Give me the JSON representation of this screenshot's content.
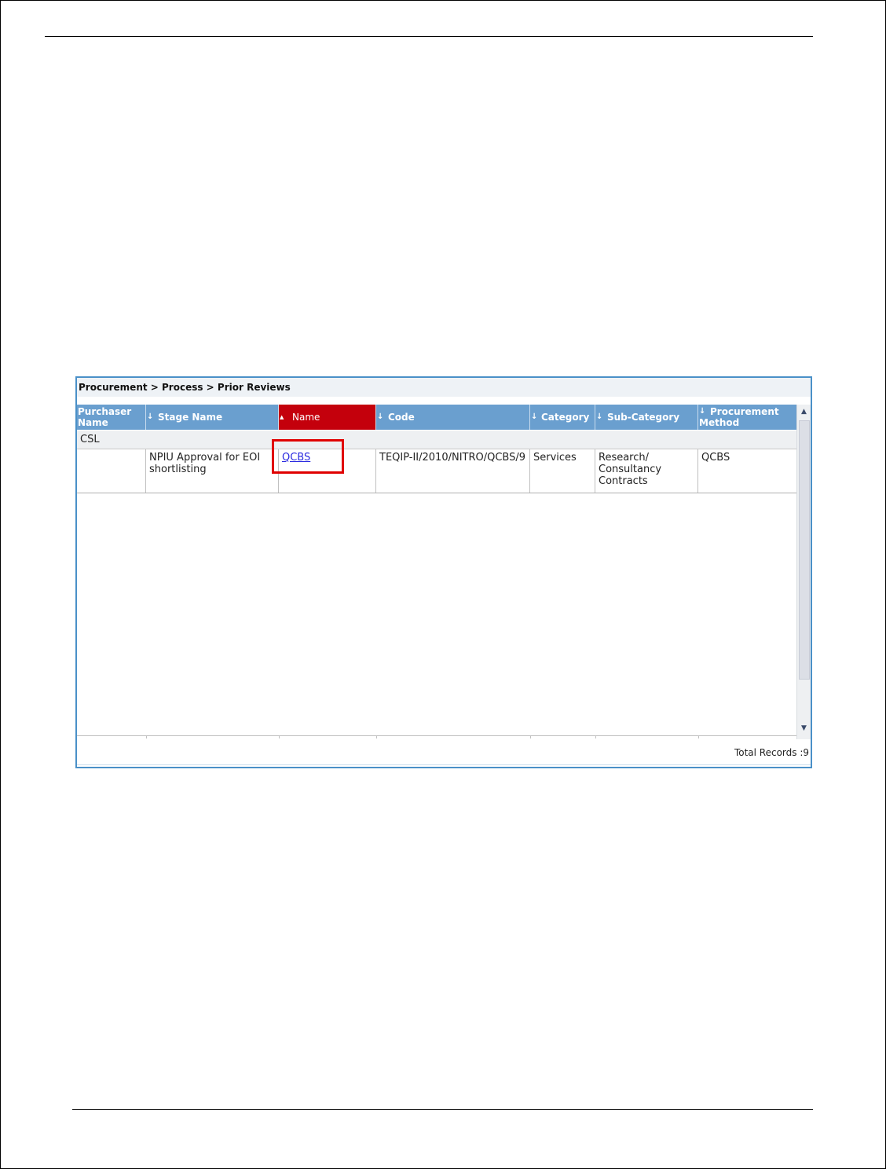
{
  "breadcrumb": "Procurement > Process > Prior Reviews",
  "columns": [
    {
      "sort_icon": "",
      "label_line1": "Purchaser",
      "label_line2": "Name"
    },
    {
      "sort_icon": "↓",
      "label": "Stage Name"
    },
    {
      "sort_icon": "▲",
      "label": "Name"
    },
    {
      "sort_icon": "↓",
      "label": "Code"
    },
    {
      "sort_icon": "↓",
      "label": "Category"
    },
    {
      "sort_icon": "↓",
      "label": "Sub-Category"
    },
    {
      "sort_icon": "↓",
      "label_line1": "Procurement",
      "label_line2": "Method"
    }
  ],
  "group": "CSL",
  "row": {
    "purchaser_name": "",
    "stage_name": "NPIU Approval for EOI shortlisting",
    "name": "QCBS",
    "code": "TEQIP-II/2010/NITRO/QCBS/9",
    "category": "Services",
    "sub_category": "Research/ Consultancy Contracts",
    "procurement_method": "QCBS"
  },
  "total_records": "Total Records :9",
  "colors": {
    "header": "#6a9fcf",
    "active_header": "#c4000c",
    "highlight": "#e00000",
    "border": "#4a90c8"
  }
}
